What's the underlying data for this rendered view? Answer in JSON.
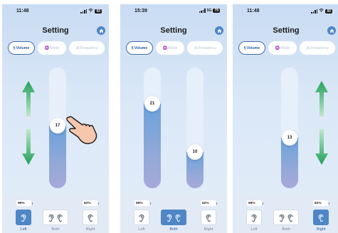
{
  "screens": [
    {
      "status": {
        "time": "11:48",
        "network": "",
        "battery": "93"
      },
      "title": "Setting",
      "tabs": [
        {
          "label": "Volume",
          "active": true
        },
        {
          "label": "Mode",
          "active": false
        },
        {
          "label": "Frequency",
          "active": false
        }
      ],
      "sliders": [
        {
          "label": "17",
          "level": 0.52
        }
      ],
      "arrows": [
        "up",
        "down"
      ],
      "hand_gesture": true,
      "battery_left": "99%",
      "battery_right": "62%",
      "buttons": [
        {
          "label": "Left",
          "selected": true
        },
        {
          "label": "Both",
          "selected": false
        },
        {
          "label": "Right",
          "selected": false
        }
      ]
    },
    {
      "status": {
        "time": "15:39",
        "network": "5G",
        "battery": "79"
      },
      "title": "Setting",
      "tabs": [
        {
          "label": "Volume",
          "active": true
        },
        {
          "label": "Mode",
          "active": false
        },
        {
          "label": "Frequency",
          "active": false
        }
      ],
      "sliders": [
        {
          "label": "21",
          "level": 0.7
        },
        {
          "label": "10",
          "level": 0.3
        }
      ],
      "battery_left": "99%",
      "battery_right": "62%",
      "buttons": [
        {
          "label": "Left",
          "selected": false
        },
        {
          "label": "Both",
          "selected": true
        },
        {
          "label": "Right",
          "selected": false
        }
      ]
    },
    {
      "status": {
        "time": "11:48",
        "network": "",
        "battery": "93"
      },
      "title": "Setting",
      "tabs": [
        {
          "label": "Volume",
          "active": true
        },
        {
          "label": "Mode",
          "active": false
        },
        {
          "label": "Frequency",
          "active": false
        }
      ],
      "sliders": [
        {
          "label": "13",
          "level": 0.42
        }
      ],
      "arrows": [
        "up",
        "down"
      ],
      "battery_left": "99%",
      "battery_right": "62%",
      "buttons": [
        {
          "label": "Left",
          "selected": false
        },
        {
          "label": "Both",
          "selected": false
        },
        {
          "label": "Right",
          "selected": true
        }
      ]
    }
  ],
  "colors": {
    "accent": "#4e86c6",
    "arrow_green": "#27a35a",
    "background_top": "#c9dcf3"
  }
}
